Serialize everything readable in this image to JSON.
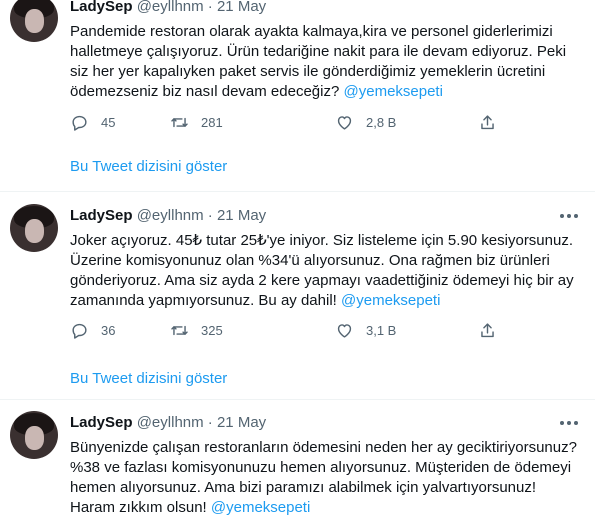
{
  "tweets": [
    {
      "name": "LadySep",
      "handle": "@eyllhnm",
      "dot": "·",
      "date": "21 May",
      "lines": [
        "Pandemide restoran olarak ayakta kalmaya,kira ve personel giderlerimizi",
        "halletmeye çalışıyoruz. Ürün tedariğine nakit para ile devam ediyoruz. Peki",
        "siz her yer kapalıyken paket servis ile gönderdiğimiz yemeklerin ücretini"
      ],
      "last_line": "ödemezseniz biz nasıl devam edeceğiz?",
      "mention": "@yemeksepeti",
      "replies": "45",
      "retweets": "281",
      "likes": "2,8 B",
      "show_thread": "Bu Tweet dizisini göster"
    },
    {
      "name": "LadySep",
      "handle": "@eyllhnm",
      "dot": "·",
      "date": "21 May",
      "lines": [
        "Joker açıyoruz. 45₺ tutar 25₺'ye iniyor. Siz listeleme için 5.90 kesiyorsunuz.",
        "Üzerine komisyonunuz olan %34'ü alıyorsunuz. Ona rağmen biz ürünleri",
        "gönderiyoruz. Ama siz ayda 2 kere yapmayı vaadettiğiniz ödemeyi hiç bir ay"
      ],
      "last_line": "zamanında yapmıyorsunuz. Bu ay dahil!",
      "mention": "@yemeksepeti",
      "replies": "36",
      "retweets": "325",
      "likes": "3,1 B",
      "show_thread": "Bu Tweet dizisini göster"
    },
    {
      "name": "LadySep",
      "handle": "@eyllhnm",
      "dot": "·",
      "date": "21 May",
      "lines": [
        "Bünyenizde çalışan restoranların ödemesini neden her ay geciktiriyorsunuz?",
        "%38 ve fazlası komisyonunuzu hemen alıyorsunuz. Müşteriden de ödemeyi",
        "hemen alıyorsunuz. Ama bizi paramızı alabilmek için yalvartıyorsunuz!"
      ],
      "last_line": "Haram zıkkım olsun!",
      "mention": "@yemeksepeti"
    }
  ]
}
